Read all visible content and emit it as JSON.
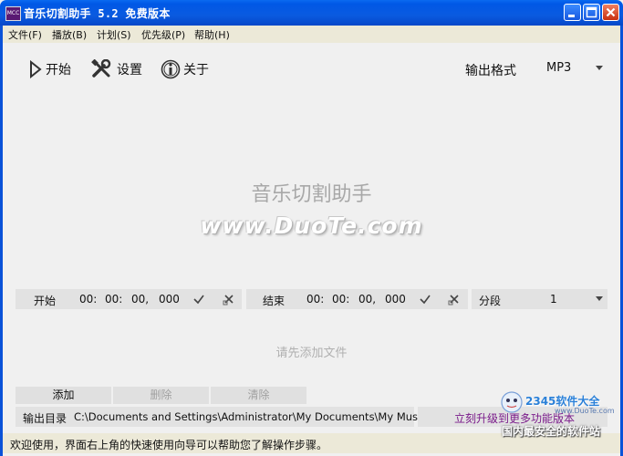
{
  "window": {
    "title": "音乐切割助手 5.2 免费版本",
    "icon_text": "MCC",
    "controls": [
      "minimize-icon",
      "maximize-icon",
      "close-icon"
    ]
  },
  "menu": [
    {
      "label": "文件(F)"
    },
    {
      "label": "播放(B)"
    },
    {
      "label": "计划(S)"
    },
    {
      "label": "优先级(P)"
    },
    {
      "label": "帮助(H)"
    }
  ],
  "toolbar": {
    "start_label": "开始",
    "settings_label": "设置",
    "about_label": "关于",
    "output_format_label": "输出格式",
    "output_format_value": "MP3"
  },
  "center": {
    "app_name": "音乐切割助手",
    "watermark": "www.DuoTe.com"
  },
  "timing": {
    "start_label": "开始",
    "start_h": "00:",
    "start_m": "00:",
    "start_s": "00,",
    "start_ms": "000",
    "end_label": "结束",
    "end_h": "00:",
    "end_m": "00:",
    "end_s": "00,",
    "end_ms": "000",
    "segment_label": "分段",
    "segment_value": "1"
  },
  "hint": "请先添加文件",
  "actions": {
    "add": "添加",
    "delete": "删除",
    "clear": "清除"
  },
  "output": {
    "label": "输出目录",
    "path": "C:\\Documents and Settings\\Administrator\\My Documents\\My Music\\",
    "upgrade_link": "立刻升级到更多功能版本"
  },
  "status": "欢迎使用，界面右上角的快速使用向导可以帮助您了解操作步骤。",
  "corner_logo": {
    "brand": "2345软件大全",
    "site": "www.DuoTe.com",
    "slogan": "国内最安全的软件站"
  },
  "colors": {
    "title_bar": "#0058e6",
    "upgrade_link": "#7a1a8a",
    "disabled_text": "#a0a0a0"
  }
}
